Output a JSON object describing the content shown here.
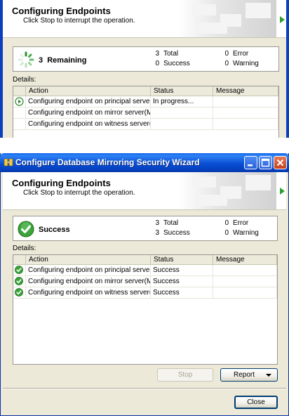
{
  "top": {
    "header": {
      "title": "Configuring Endpoints",
      "subtitle": "Click Stop to interrupt the operation."
    },
    "status": {
      "main": "3  Remaining",
      "icon": "progress-spinner-icon",
      "counts": [
        {
          "value": "3",
          "label": "Total"
        },
        {
          "value": "0",
          "label": "Success"
        },
        {
          "value": "0",
          "label": "Error"
        },
        {
          "value": "0",
          "label": "Warning"
        }
      ]
    },
    "details_label": "Details:",
    "columns": [
      "Action",
      "Status",
      "Message"
    ],
    "rows": [
      {
        "icon": "in-progress-icon",
        "action": "Configuring endpoint on principal server(...",
        "status": "In progress...",
        "message": ""
      },
      {
        "icon": "",
        "action": "Configuring endpoint on mirror server(M...",
        "status": "",
        "message": ""
      },
      {
        "icon": "",
        "action": "Configuring endpoint on witness server(...",
        "status": "",
        "message": ""
      }
    ]
  },
  "window": {
    "title": "Configure Database Mirroring Security Wizard",
    "header": {
      "title": "Configuring Endpoints",
      "subtitle": "Click Stop to interrupt the operation."
    },
    "status": {
      "main": "Success",
      "icon": "success-check-icon",
      "counts": [
        {
          "value": "3",
          "label": "Total"
        },
        {
          "value": "3",
          "label": "Success"
        },
        {
          "value": "0",
          "label": "Error"
        },
        {
          "value": "0",
          "label": "Warning"
        }
      ]
    },
    "details_label": "Details:",
    "columns": [
      "Action",
      "Status",
      "Message"
    ],
    "rows": [
      {
        "icon": "success-check-icon",
        "action": "Configuring endpoint on principal server(...",
        "status": "Success",
        "message": ""
      },
      {
        "icon": "success-check-icon",
        "action": "Configuring endpoint on mirror server(M...",
        "status": "Success",
        "message": ""
      },
      {
        "icon": "success-check-icon",
        "action": "Configuring endpoint on witness server(...",
        "status": "Success",
        "message": ""
      }
    ],
    "buttons": {
      "stop": "Stop",
      "report": "Report",
      "close": "Close"
    }
  },
  "colors": {
    "accent_green": "#2ca02c",
    "titlebar_blue": "#0a4fd4",
    "dialog_bg": "#ece9d8"
  }
}
